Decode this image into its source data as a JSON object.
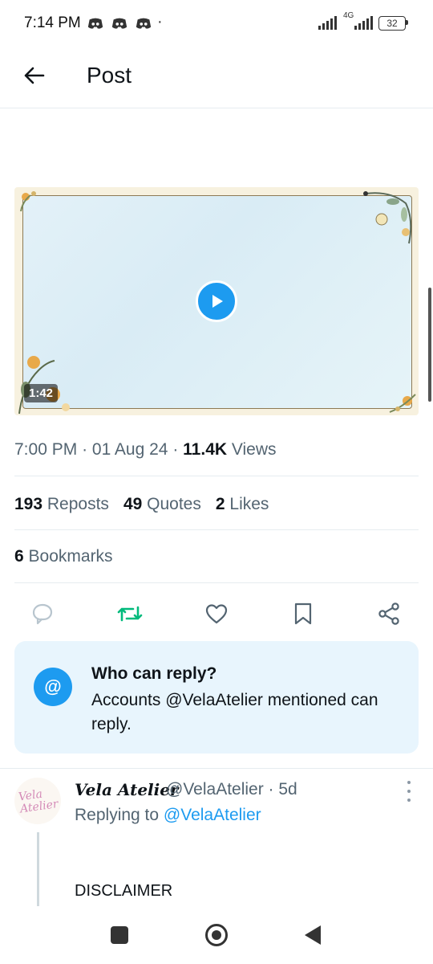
{
  "status_bar": {
    "time": "7:14 PM",
    "dot": "·",
    "network": "4G",
    "battery": "32"
  },
  "header": {
    "back_icon": "arrow-left-icon",
    "title": "Post"
  },
  "media": {
    "type": "video",
    "duration": "1:42",
    "play_icon": "play-icon"
  },
  "post_meta": {
    "time": "7:00 PM",
    "date": "01 Aug 24",
    "views_count": "11.4K",
    "views_label": "Views"
  },
  "stats": {
    "reposts_count": "193",
    "reposts_label": "Reposts",
    "quotes_count": "49",
    "quotes_label": "Quotes",
    "likes_count": "2",
    "likes_label": "Likes",
    "bookmarks_count": "6",
    "bookmarks_label": "Bookmarks"
  },
  "actions": [
    {
      "name": "reply",
      "icon": "speech-bubble-icon",
      "color": "#b8c5ce"
    },
    {
      "name": "repost",
      "icon": "repost-icon",
      "color": "#00ba7c"
    },
    {
      "name": "like",
      "icon": "heart-icon",
      "color": "#536471"
    },
    {
      "name": "bookmark",
      "icon": "bookmark-icon",
      "color": "#536471"
    },
    {
      "name": "share",
      "icon": "share-icon",
      "color": "#536471"
    }
  ],
  "who_can_reply": {
    "icon": "@",
    "title": "Who can reply?",
    "body": "Accounts @VelaAtelier mentioned can reply."
  },
  "reply": {
    "display_name": "Vela Atelier",
    "handle_time": "@VelaAtelier · 5d",
    "replying_prefix": "Replying to",
    "replying_to": "@VelaAtelier",
    "text": "DISCLAIMER",
    "avatar_text": "Vela Atelier"
  },
  "colors": {
    "accent": "#1d9bf0",
    "repost": "#00ba7c",
    "muted": "#536471"
  }
}
